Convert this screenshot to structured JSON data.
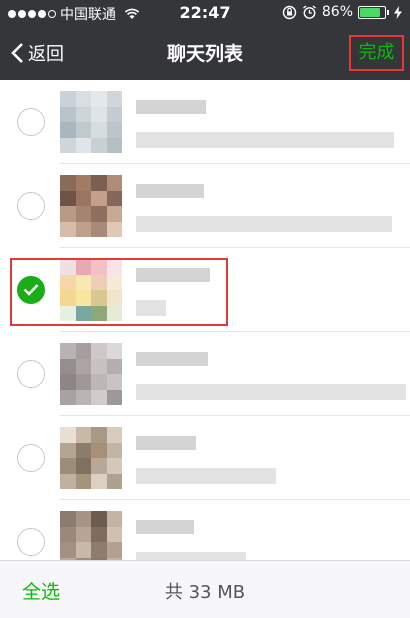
{
  "statusbar": {
    "carrier": "中国联通",
    "time": "22:47",
    "battery_text": "86%",
    "battery_level": 0.86
  },
  "navbar": {
    "back_label": "返回",
    "title": "聊天列表",
    "done_label": "完成"
  },
  "bottombar": {
    "select_all_label": "全选",
    "total_label": "共 33 MB"
  },
  "chats": [
    {
      "selected": false
    },
    {
      "selected": false
    },
    {
      "selected": true
    },
    {
      "selected": false
    },
    {
      "selected": false
    },
    {
      "selected": false
    }
  ],
  "colors": {
    "accent": "#09bb07",
    "check": "#1aad19",
    "highlight": "#e53935",
    "bar": "#34363a"
  }
}
